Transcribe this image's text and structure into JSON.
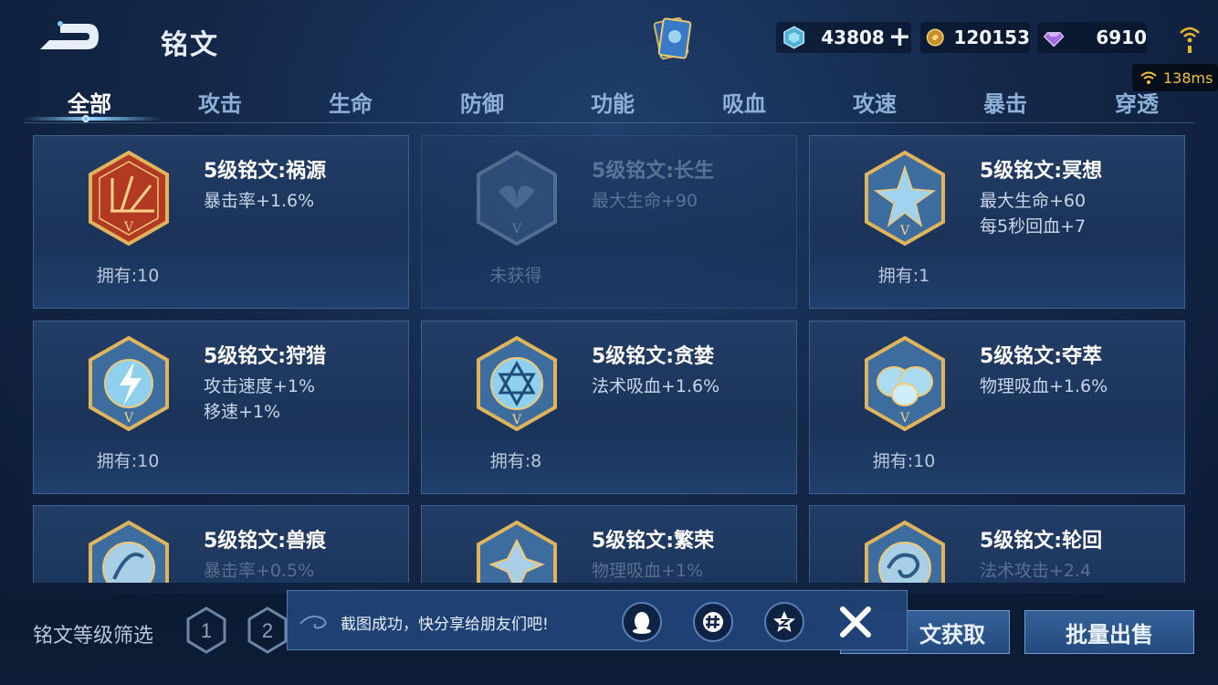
{
  "header": {
    "title": "铭文",
    "currencies": [
      {
        "icon": "diamond-ticket-icon",
        "value": "43808"
      },
      {
        "icon": "gold-coin-icon",
        "value": "120153"
      },
      {
        "icon": "purple-gem-icon",
        "value": "6910"
      }
    ],
    "ping": "138ms"
  },
  "tabs": [
    {
      "label": "全部",
      "active": true
    },
    {
      "label": "攻击"
    },
    {
      "label": "生命"
    },
    {
      "label": "防御"
    },
    {
      "label": "功能"
    },
    {
      "label": "吸血"
    },
    {
      "label": "攻速"
    },
    {
      "label": "暴击"
    },
    {
      "label": "穿透"
    }
  ],
  "inscriptions": [
    {
      "name": "5级铭文:祸源",
      "attrs": [
        "暴击率+1.6%"
      ],
      "owned": "拥有:10",
      "color": "#c2442c",
      "emblem": "red-fan-emblem-icon"
    },
    {
      "name": "5级铭文:长生",
      "attrs": [
        "最大生命+90"
      ],
      "owned": "未获得",
      "color": "#5d7aa0",
      "emblem": "whale-tail-emblem-icon"
    },
    {
      "name": "5级铭文:冥想",
      "attrs": [
        "最大生命+60",
        "每5秒回血+7"
      ],
      "owned": "拥有:1",
      "color": "#9fd3f0",
      "emblem": "crystal-star-emblem-icon"
    },
    {
      "name": "5级铭文:狩猎",
      "attrs": [
        "攻击速度+1%",
        "移速+1%"
      ],
      "owned": "拥有:10",
      "color": "#8fd0ef",
      "emblem": "lightning-emblem-icon"
    },
    {
      "name": "5级铭文:贪婪",
      "attrs": [
        "法术吸血+1.6%"
      ],
      "owned": "拥有:8",
      "color": "#8fd0ef",
      "emblem": "hexagram-emblem-icon"
    },
    {
      "name": "5级铭文:夺萃",
      "attrs": [
        "物理吸血+1.6%"
      ],
      "owned": "拥有:10",
      "color": "#a9dcf3",
      "emblem": "knot-emblem-icon"
    },
    {
      "name": "5级铭文:兽痕",
      "attrs": [
        "暴击率+0.5%"
      ],
      "owned": "",
      "color": "#a8cfe6",
      "emblem": "claw-emblem-icon"
    },
    {
      "name": "5级铭文:繁荣",
      "attrs": [
        "物理吸血+1%"
      ],
      "owned": "",
      "color": "#a8cfe6",
      "emblem": "crown-emblem-icon"
    },
    {
      "name": "5级铭文:轮回",
      "attrs": [
        "法术攻击+2.4"
      ],
      "owned": "",
      "color": "#a8cfe6",
      "emblem": "swirl-emblem-icon"
    }
  ],
  "bottom": {
    "filter_label": "铭文等级筛选",
    "levels": [
      "1",
      "2"
    ],
    "obtain_button": "文获取",
    "sell_button": "批量出售"
  },
  "toast": {
    "message": "截图成功，快分享给朋友们吧!",
    "share_icons": [
      "qq-penguin-icon",
      "wechat-moments-icon",
      "qzone-star-icon"
    ]
  }
}
